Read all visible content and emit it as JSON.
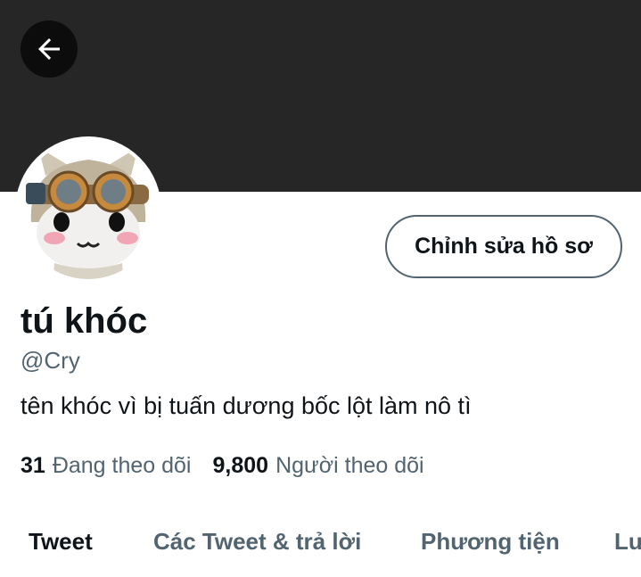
{
  "header": {
    "back_icon": "arrow-left-icon",
    "banner_color": "#262626"
  },
  "profile": {
    "avatar_icon": "cat-aviator-avatar",
    "edit_button_label": "Chỉnh sửa hồ sơ",
    "display_name": "tú khóc",
    "handle": "@Cry",
    "bio": "tên khóc vì bị tuấn dương bốc lột làm nô tì"
  },
  "stats": {
    "following_count": "31",
    "following_label": "Đang theo dõi",
    "followers_count": "9,800",
    "followers_label": "Người theo dõi"
  },
  "tabs": [
    {
      "label": "Tweet",
      "active": true
    },
    {
      "label": "Các Tweet & trả lời",
      "active": false
    },
    {
      "label": "Phương tiện",
      "active": false
    },
    {
      "label": "Lượt thích",
      "active": false
    }
  ],
  "colors": {
    "primary_text": "#0f1419",
    "secondary_text": "#536471"
  }
}
